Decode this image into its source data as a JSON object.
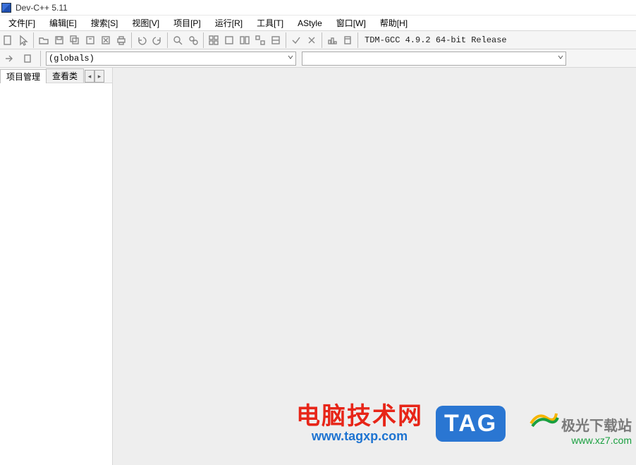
{
  "title": "Dev-C++ 5.11",
  "menu": {
    "file": "文件[F]",
    "edit": "编辑[E]",
    "search": "搜索[S]",
    "view": "视图[V]",
    "project": "项目[P]",
    "run": "运行[R]",
    "tools": "工具[T]",
    "astyle": "AStyle",
    "window": "窗口[W]",
    "help": "帮助[H]"
  },
  "compiler_label": "TDM-GCC 4.9.2 64-bit Release",
  "combo": {
    "globals": "(globals)"
  },
  "tabs": {
    "project": "项目管理",
    "view": "查看类"
  },
  "watermark": {
    "red_line1": "电脑技术网",
    "red_line2": "www.tagxp.com",
    "tag": "TAG",
    "jg1": "极光下载站",
    "jg2": "www.xz7.com"
  }
}
